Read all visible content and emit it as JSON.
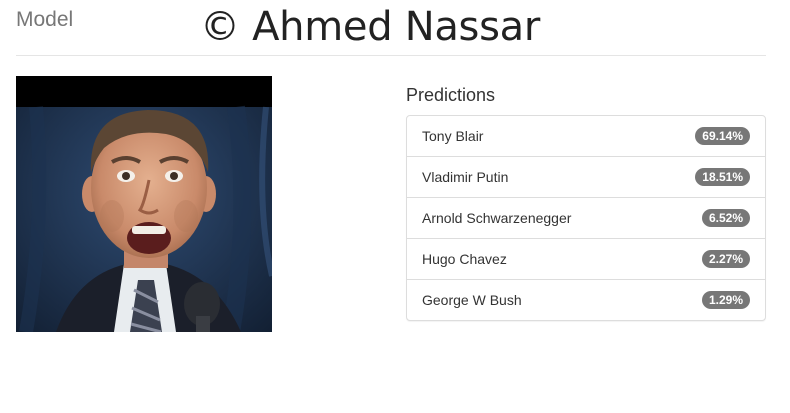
{
  "header": {
    "model_label": "Model",
    "watermark": "© Ahmed Nassar"
  },
  "photo": {
    "subject": "portrait-photo"
  },
  "predictions": {
    "title": "Predictions",
    "items": [
      {
        "name": "Tony Blair",
        "confidence": "69.14%"
      },
      {
        "name": "Vladimir Putin",
        "confidence": "18.51%"
      },
      {
        "name": "Arnold Schwarzenegger",
        "confidence": "6.52%"
      },
      {
        "name": "Hugo Chavez",
        "confidence": "2.27%"
      },
      {
        "name": "George W Bush",
        "confidence": "1.29%"
      }
    ]
  },
  "colors": {
    "badge": "#777777",
    "divider": "#dddddd",
    "muted_text": "#777777"
  }
}
